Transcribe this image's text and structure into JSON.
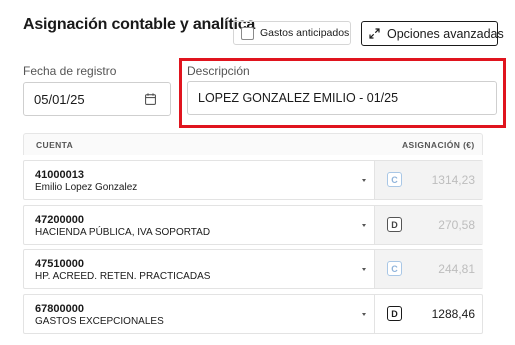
{
  "header": {
    "title": "Asignación contable y analítica",
    "gastos_anticipados_label": "Gastos anticipados",
    "gastos_anticipados_checked": false,
    "opciones_avanzadas_label": "Opciones avanzadas"
  },
  "form": {
    "fecha_label": "Fecha de registro",
    "fecha_value": "05/01/25",
    "descripcion_label": "Descripción",
    "descripcion_value": "LOPEZ GONZALEZ EMILIO - 01/25"
  },
  "table": {
    "col_cuenta": "CUENTA",
    "col_asignacion": "ASIGNACIÓN (€)",
    "rows": [
      {
        "code": "41000013",
        "name": "Emilio Lopez Gonzalez",
        "side": "C",
        "amount": "1314,23",
        "enabled": false
      },
      {
        "code": "47200000",
        "name": "HACIENDA PÚBLICA, IVA SOPORTAD",
        "side": "D",
        "amount": "270,58",
        "enabled": false
      },
      {
        "code": "47510000",
        "name": "HP. ACREED. RETEN. PRACTICADAS",
        "side": "C",
        "amount": "244,81",
        "enabled": false
      },
      {
        "code": "67800000",
        "name": "GASTOS EXCEPCIONALES",
        "side": "D",
        "amount": "1288,46",
        "enabled": true
      }
    ]
  },
  "colors": {
    "highlight_border": "#e0141e",
    "credit_badge": "#8fb3da",
    "muted_amount": "#bdbdbd"
  }
}
